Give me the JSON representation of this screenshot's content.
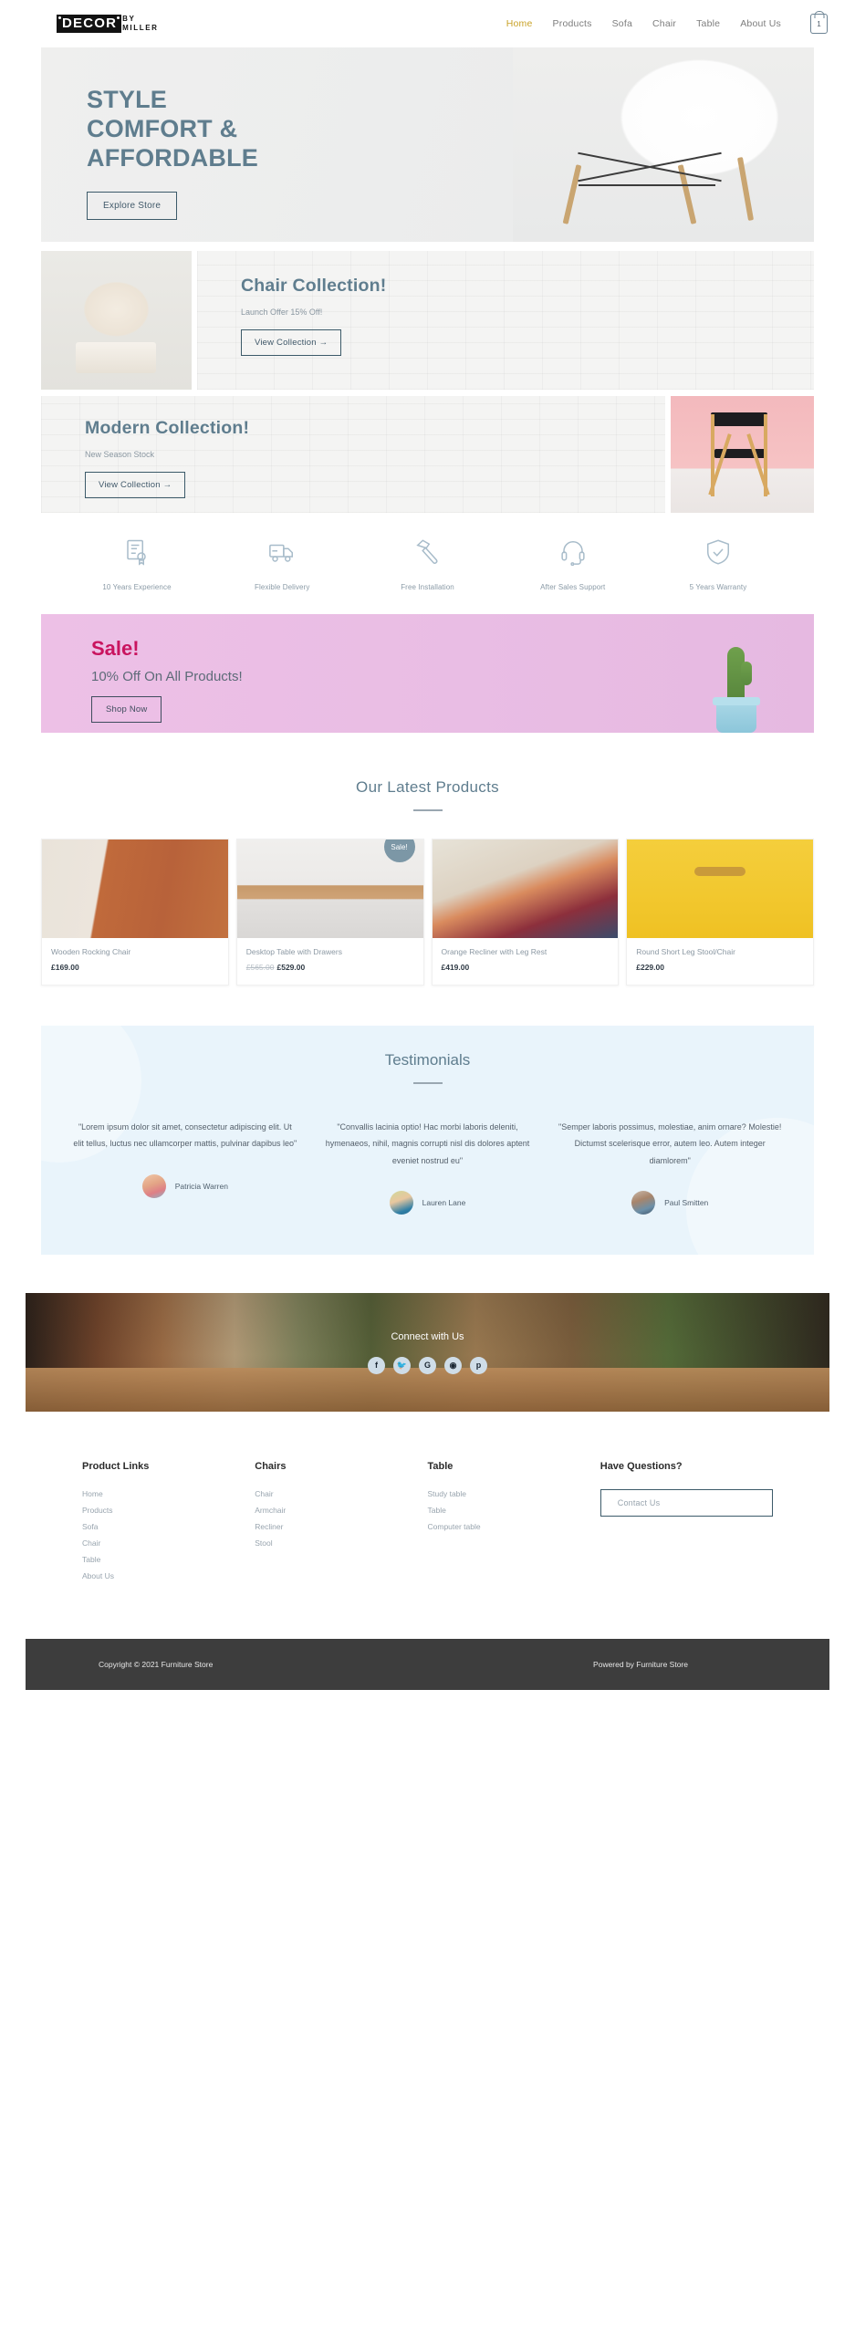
{
  "header": {
    "logo_main": "DECOR",
    "logo_by": "BY",
    "logo_miller": "MILLER",
    "nav": [
      {
        "label": "Home",
        "active": true
      },
      {
        "label": "Products",
        "active": false
      },
      {
        "label": "Sofa",
        "active": false
      },
      {
        "label": "Chair",
        "active": false
      },
      {
        "label": "Table",
        "active": false
      },
      {
        "label": "About Us",
        "active": false
      }
    ],
    "cart_count": "1",
    "cart_icon": "shopping-bag-icon",
    "accent_color": "#c9a227"
  },
  "hero": {
    "line1": "STYLE",
    "line2": "COMFORT &",
    "line3": "AFFORDABLE",
    "cta": "Explore Store"
  },
  "chair_collection": {
    "title": "Chair Collection!",
    "subtitle": "Launch Offer 15% Off!",
    "cta": "View Collection →"
  },
  "modern_collection": {
    "title": "Modern Collection!",
    "subtitle": "New Season Stock",
    "cta": "View Collection →"
  },
  "features": [
    {
      "icon": "certificate-icon",
      "label": "10 Years Experience"
    },
    {
      "icon": "delivery-truck-icon",
      "label": "Flexible Delivery"
    },
    {
      "icon": "hammer-icon",
      "label": "Free Installation"
    },
    {
      "icon": "headset-icon",
      "label": "After Sales Support"
    },
    {
      "icon": "shield-check-icon",
      "label": "5 Years Warranty"
    }
  ],
  "sale_banner": {
    "title": "Sale!",
    "subtitle": "10% Off On All Products!",
    "cta": "Shop Now",
    "title_color": "#c9145f"
  },
  "products_section": {
    "title": "Our Latest Products",
    "items": [
      {
        "name": "Wooden Rocking Chair",
        "price": "£169.00",
        "old_price": "",
        "badge": ""
      },
      {
        "name": "Desktop Table with Drawers",
        "price": "£529.00",
        "old_price": "£565.00",
        "badge": "Sale!"
      },
      {
        "name": "Orange Recliner with Leg Rest",
        "price": "£419.00",
        "old_price": "",
        "badge": ""
      },
      {
        "name": "Round Short Leg Stool/Chair",
        "price": "£229.00",
        "old_price": "",
        "badge": ""
      }
    ]
  },
  "testimonials_section": {
    "title": "Testimonials",
    "items": [
      {
        "quote": "\"Lorem ipsum dolor sit amet, consectetur adipiscing elit. Ut elit tellus, luctus nec ullamcorper mattis, pulvinar dapibus leo\"",
        "name": "Patricia Warren"
      },
      {
        "quote": "\"Convallis lacinia optio! Hac morbi laboris deleniti, hymenaeos, nihil, magnis corrupti nisl dis dolores aptent eveniet nostrud eu\"",
        "name": "Lauren Lane"
      },
      {
        "quote": "\"Semper laboris possimus, molestiae, anim ornare? Molestie! Dictumst scelerisque error, autem leo. Autem integer diamlorem\"",
        "name": "Paul Smitten"
      }
    ]
  },
  "connect": {
    "title": "Connect with Us",
    "socials": [
      {
        "icon": "facebook-icon",
        "glyph": "f"
      },
      {
        "icon": "twitter-icon",
        "glyph": "🐦"
      },
      {
        "icon": "google-icon",
        "glyph": "G"
      },
      {
        "icon": "instagram-icon",
        "glyph": "◉"
      },
      {
        "icon": "pinterest-icon",
        "glyph": "p"
      }
    ]
  },
  "footer": {
    "columns": [
      {
        "title": "Product Links",
        "links": [
          "Home",
          "Products",
          "Sofa",
          "Chair",
          "Table",
          "About Us"
        ]
      },
      {
        "title": "Chairs",
        "links": [
          "Chair",
          "Armchair",
          "Recliner",
          "Stool"
        ]
      },
      {
        "title": "Table",
        "links": [
          "Study table",
          "Table",
          "Computer table"
        ]
      }
    ],
    "questions_title": "Have Questions?",
    "contact_cta": "Contact Us"
  },
  "copyright": {
    "left": "Copyright © 2021 Furniture Store",
    "right": "Powered by Furniture Store"
  }
}
